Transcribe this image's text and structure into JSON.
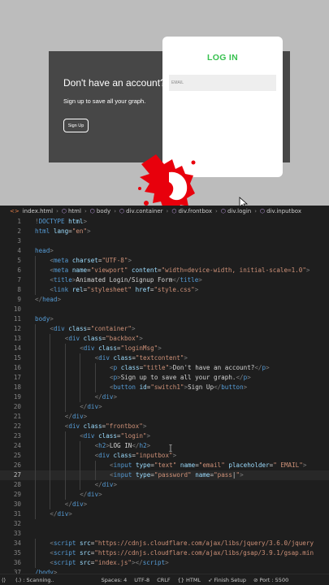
{
  "preview": {
    "backbox_title": "Don't have an account?",
    "backbox_subtitle": "Sign up to save all your graph.",
    "signup_label": "Sign Up",
    "login_heading": "LOG IN",
    "email_placeholder": "EMAIL",
    "accent_color": "#37c14f",
    "splash_color": "#e8000c"
  },
  "breadcrumb": [
    "index.html",
    "html",
    "body",
    "div.container",
    "div.frontbox",
    "div.login",
    "div.inputbox"
  ],
  "code_lines": [
    {
      "n": "1",
      "indent": 0,
      "tokens": [
        [
          "br",
          "!"
        ],
        [
          "tg",
          "DOCTYPE"
        ],
        [
          "tx",
          " "
        ],
        [
          "at",
          "html"
        ],
        [
          "br",
          ">"
        ]
      ]
    },
    {
      "n": "2",
      "indent": 0,
      "tokens": [
        [
          "tg",
          "html"
        ],
        [
          "tx",
          " "
        ],
        [
          "at",
          "lang"
        ],
        [
          "tx",
          "="
        ],
        [
          "st",
          "\"en\""
        ],
        [
          "br",
          ">"
        ]
      ]
    },
    {
      "n": "3",
      "indent": 0,
      "tokens": []
    },
    {
      "n": "4",
      "indent": 0,
      "tokens": [
        [
          "tg",
          "head"
        ],
        [
          "br",
          ">"
        ]
      ]
    },
    {
      "n": "5",
      "indent": 1,
      "tokens": [
        [
          "br",
          "<"
        ],
        [
          "tg",
          "meta"
        ],
        [
          "tx",
          " "
        ],
        [
          "at",
          "charset"
        ],
        [
          "tx",
          "="
        ],
        [
          "st",
          "\"UTF-8\""
        ],
        [
          "br",
          ">"
        ]
      ]
    },
    {
      "n": "6",
      "indent": 1,
      "tokens": [
        [
          "br",
          "<"
        ],
        [
          "tg",
          "meta"
        ],
        [
          "tx",
          " "
        ],
        [
          "at",
          "name"
        ],
        [
          "tx",
          "="
        ],
        [
          "st",
          "\"viewport\""
        ],
        [
          "tx",
          " "
        ],
        [
          "at",
          "content"
        ],
        [
          "tx",
          "="
        ],
        [
          "st",
          "\"width=device-width, initial-scale=1.0\""
        ],
        [
          "br",
          ">"
        ]
      ]
    },
    {
      "n": "7",
      "indent": 1,
      "tokens": [
        [
          "br",
          "<"
        ],
        [
          "tg",
          "title"
        ],
        [
          "br",
          ">"
        ],
        [
          "tx",
          "Animated Login/Signup Form"
        ],
        [
          "br",
          "</"
        ],
        [
          "tg",
          "title"
        ],
        [
          "br",
          ">"
        ]
      ]
    },
    {
      "n": "8",
      "indent": 1,
      "tokens": [
        [
          "br",
          "<"
        ],
        [
          "tg",
          "link"
        ],
        [
          "tx",
          " "
        ],
        [
          "at",
          "rel"
        ],
        [
          "tx",
          "="
        ],
        [
          "st",
          "\"stylesheet\""
        ],
        [
          "tx",
          " "
        ],
        [
          "at",
          "href"
        ],
        [
          "tx",
          "="
        ],
        [
          "st",
          "\"style.css\""
        ],
        [
          "br",
          ">"
        ]
      ]
    },
    {
      "n": "9",
      "indent": 0,
      "tokens": [
        [
          "br",
          "</"
        ],
        [
          "tg",
          "head"
        ],
        [
          "br",
          ">"
        ]
      ]
    },
    {
      "n": "10",
      "indent": 0,
      "tokens": []
    },
    {
      "n": "11",
      "indent": 0,
      "tokens": [
        [
          "tg",
          "body"
        ],
        [
          "br",
          ">"
        ]
      ]
    },
    {
      "n": "12",
      "indent": 1,
      "tokens": [
        [
          "br",
          "<"
        ],
        [
          "tg",
          "div"
        ],
        [
          "tx",
          " "
        ],
        [
          "at",
          "class"
        ],
        [
          "tx",
          "="
        ],
        [
          "st",
          "\"container\""
        ],
        [
          "br",
          ">"
        ]
      ]
    },
    {
      "n": "13",
      "indent": 2,
      "tokens": [
        [
          "br",
          "<"
        ],
        [
          "tg",
          "div"
        ],
        [
          "tx",
          " "
        ],
        [
          "at",
          "class"
        ],
        [
          "tx",
          "="
        ],
        [
          "st",
          "\"backbox\""
        ],
        [
          "br",
          ">"
        ]
      ]
    },
    {
      "n": "14",
      "indent": 3,
      "tokens": [
        [
          "br",
          "<"
        ],
        [
          "tg",
          "div"
        ],
        [
          "tx",
          " "
        ],
        [
          "at",
          "class"
        ],
        [
          "tx",
          "="
        ],
        [
          "st",
          "\"loginMsg\""
        ],
        [
          "br",
          ">"
        ]
      ]
    },
    {
      "n": "15",
      "indent": 4,
      "tokens": [
        [
          "br",
          "<"
        ],
        [
          "tg",
          "div"
        ],
        [
          "tx",
          " "
        ],
        [
          "at",
          "class"
        ],
        [
          "tx",
          "="
        ],
        [
          "st",
          "\"textcontent\""
        ],
        [
          "br",
          ">"
        ]
      ]
    },
    {
      "n": "16",
      "indent": 5,
      "tokens": [
        [
          "br",
          "<"
        ],
        [
          "tg",
          "p"
        ],
        [
          "tx",
          " "
        ],
        [
          "at",
          "class"
        ],
        [
          "tx",
          "="
        ],
        [
          "st",
          "\"title\""
        ],
        [
          "br",
          ">"
        ],
        [
          "tx",
          "Don't have an account?"
        ],
        [
          "br",
          "</"
        ],
        [
          "tg",
          "p"
        ],
        [
          "br",
          ">"
        ]
      ]
    },
    {
      "n": "17",
      "indent": 5,
      "tokens": [
        [
          "br",
          "<"
        ],
        [
          "tg",
          "p"
        ],
        [
          "br",
          ">"
        ],
        [
          "tx",
          "Sign up to save all your graph."
        ],
        [
          "br",
          "</"
        ],
        [
          "tg",
          "p"
        ],
        [
          "br",
          ">"
        ]
      ]
    },
    {
      "n": "18",
      "indent": 5,
      "tokens": [
        [
          "br",
          "<"
        ],
        [
          "tg",
          "button"
        ],
        [
          "tx",
          " "
        ],
        [
          "at",
          "id"
        ],
        [
          "tx",
          "="
        ],
        [
          "st",
          "\"switch1\""
        ],
        [
          "br",
          ">"
        ],
        [
          "tx",
          "Sign Up"
        ],
        [
          "br",
          "</"
        ],
        [
          "tg",
          "button"
        ],
        [
          "br",
          ">"
        ]
      ]
    },
    {
      "n": "19",
      "indent": 4,
      "tokens": [
        [
          "br",
          "</"
        ],
        [
          "tg",
          "div"
        ],
        [
          "br",
          ">"
        ]
      ]
    },
    {
      "n": "20",
      "indent": 3,
      "tokens": [
        [
          "br",
          "</"
        ],
        [
          "tg",
          "div"
        ],
        [
          "br",
          ">"
        ]
      ]
    },
    {
      "n": "21",
      "indent": 2,
      "tokens": [
        [
          "br",
          "</"
        ],
        [
          "tg",
          "div"
        ],
        [
          "br",
          ">"
        ]
      ]
    },
    {
      "n": "22",
      "indent": 2,
      "tokens": [
        [
          "br",
          "<"
        ],
        [
          "tg",
          "div"
        ],
        [
          "tx",
          " "
        ],
        [
          "at",
          "class"
        ],
        [
          "tx",
          "="
        ],
        [
          "st",
          "\"frontbox\""
        ],
        [
          "br",
          ">"
        ]
      ]
    },
    {
      "n": "23",
      "indent": 3,
      "tokens": [
        [
          "br",
          "<"
        ],
        [
          "tg",
          "div"
        ],
        [
          "tx",
          " "
        ],
        [
          "at",
          "class"
        ],
        [
          "tx",
          "="
        ],
        [
          "st",
          "\"login\""
        ],
        [
          "br",
          ">"
        ]
      ]
    },
    {
      "n": "24",
      "indent": 4,
      "tokens": [
        [
          "br",
          "<"
        ],
        [
          "tg",
          "h2"
        ],
        [
          "br",
          ">"
        ],
        [
          "tx",
          "LOG IN"
        ],
        [
          "br",
          "</"
        ],
        [
          "tg",
          "h2"
        ],
        [
          "br",
          ">"
        ]
      ]
    },
    {
      "n": "25",
      "indent": 4,
      "tokens": [
        [
          "br",
          "<"
        ],
        [
          "tg",
          "div"
        ],
        [
          "tx",
          " "
        ],
        [
          "at",
          "class"
        ],
        [
          "tx",
          "="
        ],
        [
          "st",
          "\"inputbox\""
        ],
        [
          "br",
          ">"
        ]
      ]
    },
    {
      "n": "26",
      "indent": 5,
      "tokens": [
        [
          "br",
          "<"
        ],
        [
          "tg",
          "input"
        ],
        [
          "tx",
          " "
        ],
        [
          "at",
          "type"
        ],
        [
          "tx",
          "="
        ],
        [
          "st",
          "\"text\""
        ],
        [
          "tx",
          " "
        ],
        [
          "at",
          "name"
        ],
        [
          "tx",
          "="
        ],
        [
          "st",
          "\"email\""
        ],
        [
          "tx",
          " "
        ],
        [
          "at",
          "placeholder"
        ],
        [
          "tx",
          "="
        ],
        [
          "st",
          "\" EMAIL\""
        ],
        [
          "br",
          ">"
        ]
      ]
    },
    {
      "n": "27",
      "indent": 5,
      "active": true,
      "tokens": [
        [
          "br",
          "<"
        ],
        [
          "tg",
          "input"
        ],
        [
          "tx",
          " "
        ],
        [
          "at",
          "type"
        ],
        [
          "tx",
          "="
        ],
        [
          "st",
          "\"password\""
        ],
        [
          "tx",
          " "
        ],
        [
          "at",
          "name"
        ],
        [
          "tx",
          "="
        ],
        [
          "st",
          "\"pass"
        ],
        [
          "tx",
          "|"
        ],
        [
          "st",
          "\""
        ],
        [
          "br",
          ">"
        ]
      ]
    },
    {
      "n": "28",
      "indent": 4,
      "tokens": [
        [
          "br",
          "</"
        ],
        [
          "tg",
          "div"
        ],
        [
          "br",
          ">"
        ]
      ]
    },
    {
      "n": "29",
      "indent": 3,
      "tokens": [
        [
          "br",
          "</"
        ],
        [
          "tg",
          "div"
        ],
        [
          "br",
          ">"
        ]
      ]
    },
    {
      "n": "30",
      "indent": 2,
      "tokens": [
        [
          "br",
          "</"
        ],
        [
          "tg",
          "div"
        ],
        [
          "br",
          ">"
        ]
      ]
    },
    {
      "n": "31",
      "indent": 1,
      "tokens": [
        [
          "br",
          "</"
        ],
        [
          "tg",
          "div"
        ],
        [
          "br",
          ">"
        ]
      ]
    },
    {
      "n": "32",
      "indent": 0,
      "tokens": []
    },
    {
      "n": "33",
      "indent": 0,
      "tokens": []
    },
    {
      "n": "34",
      "indent": 1,
      "tokens": [
        [
          "br",
          "<"
        ],
        [
          "tg",
          "script"
        ],
        [
          "tx",
          " "
        ],
        [
          "at",
          "src"
        ],
        [
          "tx",
          "="
        ],
        [
          "st",
          "\"https://cdnjs.cloudflare.com/ajax/libs/jquery/3.6.0/jquery"
        ]
      ]
    },
    {
      "n": "35",
      "indent": 1,
      "tokens": [
        [
          "br",
          "<"
        ],
        [
          "tg",
          "script"
        ],
        [
          "tx",
          " "
        ],
        [
          "at",
          "src"
        ],
        [
          "tx",
          "="
        ],
        [
          "st",
          "\"https://cdnjs.cloudflare.com/ajax/libs/gsap/3.9.1/gsap.min"
        ]
      ]
    },
    {
      "n": "36",
      "indent": 1,
      "tokens": [
        [
          "br",
          "<"
        ],
        [
          "tg",
          "script"
        ],
        [
          "tx",
          " "
        ],
        [
          "at",
          "src"
        ],
        [
          "tx",
          "="
        ],
        [
          "st",
          "\"index.js\""
        ],
        [
          "br",
          "></"
        ],
        [
          "tg",
          "script"
        ],
        [
          "br",
          ">"
        ]
      ]
    },
    {
      "n": "37",
      "indent": 0,
      "tokens": [
        [
          "tg",
          "/body"
        ],
        [
          "br",
          ">"
        ]
      ]
    }
  ],
  "statusbar": {
    "scanning": "(.) : Scanning..",
    "spaces": "Spaces: 4",
    "encoding": "UTF-8",
    "eol": "CRLF",
    "language": "{} HTML",
    "finish_setup": "Finish Setup",
    "port": "Port : 5500"
  },
  "colors": {
    "editor_bg": "#1e1e1e",
    "tag": "#569cd6",
    "attr": "#9cdcfe",
    "string": "#ce9178"
  }
}
